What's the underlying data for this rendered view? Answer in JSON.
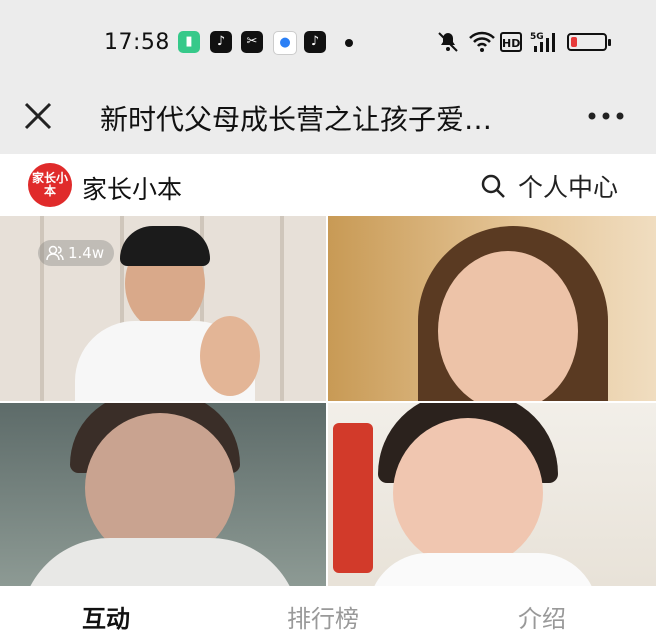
{
  "status_bar": {
    "time": "17:58",
    "icons": [
      "battery-saver-app-icon",
      "tiktok-icon",
      "capcut-icon",
      "circle-app-icon",
      "tiktok-icon",
      "dot-icon",
      "mute-icon",
      "wifi-icon",
      "hd-icon",
      "signal-5g-icon",
      "battery-low-icon"
    ],
    "hd_label": "HD",
    "signal_label": "5G",
    "battery_color": "#e63a3a"
  },
  "title_bar": {
    "title": "新时代父母成长营之让孩子爱…"
  },
  "app_header": {
    "logo_text": "家长小本",
    "brand": "家长小本",
    "personal_center": "个人中心"
  },
  "video_grid": {
    "viewer_count": "1.4w"
  },
  "tabs": {
    "items": [
      "互动",
      "排行榜",
      "介绍"
    ],
    "active": "互动"
  }
}
